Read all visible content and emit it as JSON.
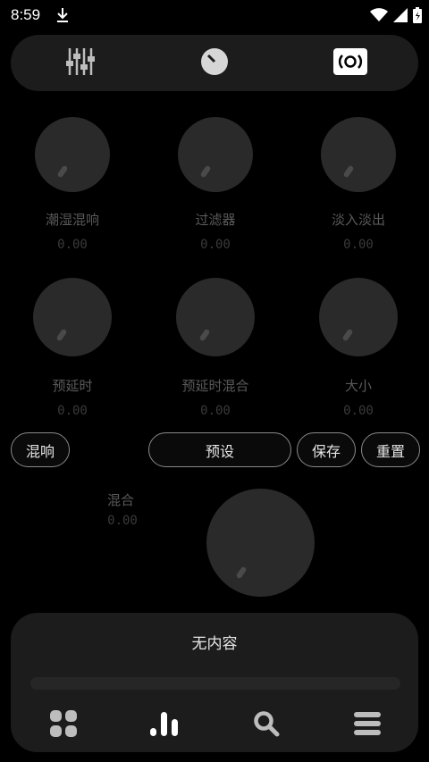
{
  "status_bar": {
    "time": "8:59",
    "icons": [
      "download-icon",
      "wifi-icon",
      "signal-icon",
      "battery-icon"
    ]
  },
  "top_tabs": [
    {
      "name": "equalizer-tab",
      "icon": "equalizer-sliders-icon"
    },
    {
      "name": "knob-tab",
      "icon": "knob-icon"
    },
    {
      "name": "reverb-tab",
      "icon": "reverb-icon",
      "active": true
    }
  ],
  "knobs": [
    {
      "label": "潮湿混响",
      "value": "0.00"
    },
    {
      "label": "过滤器",
      "value": "0.00"
    },
    {
      "label": "淡入淡出",
      "value": "0.00"
    },
    {
      "label": "预延时",
      "value": "0.00"
    },
    {
      "label": "预延时混合",
      "value": "0.00"
    },
    {
      "label": "大小",
      "value": "0.00"
    }
  ],
  "controls": {
    "reverb": "混响",
    "preset": "预设",
    "save": "保存",
    "reset": "重置"
  },
  "mix": {
    "label": "混合",
    "value": "0.00"
  },
  "player": {
    "title": "无内容"
  },
  "bottom_nav": [
    "grid-icon",
    "bars-chart-icon",
    "search-icon",
    "menu-icon"
  ],
  "colors": {
    "background": "#000000",
    "panel": "#1c1c1c",
    "knob": "#2a2a2a"
  }
}
